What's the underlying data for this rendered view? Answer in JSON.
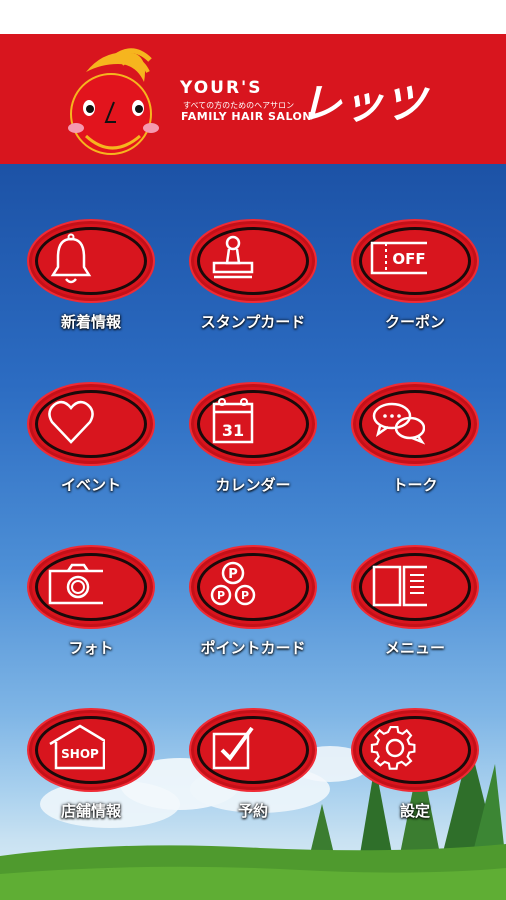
{
  "header": {
    "brand_line1": "YOUR'S",
    "brand_tagline": "すべての方のためのヘアサロン",
    "brand_line2": "FAMILY HAIR SALON",
    "brand_name": "レッツ",
    "accent_color": "#d8151e"
  },
  "menu": {
    "items": [
      {
        "label": "新着情報",
        "icon": "bell-icon"
      },
      {
        "label": "スタンプカード",
        "icon": "stamp-icon"
      },
      {
        "label": "クーポン",
        "icon": "coupon-icon",
        "icon_text": "OFF"
      },
      {
        "label": "イベント",
        "icon": "heart-icon"
      },
      {
        "label": "カレンダー",
        "icon": "calendar-icon",
        "icon_text": "31"
      },
      {
        "label": "トーク",
        "icon": "chat-bubbles-icon"
      },
      {
        "label": "フォト",
        "icon": "camera-icon"
      },
      {
        "label": "ポイントカード",
        "icon": "points-icon",
        "icon_text": "P"
      },
      {
        "label": "メニュー",
        "icon": "open-book-icon"
      },
      {
        "label": "店舗情報",
        "icon": "shop-icon",
        "icon_text": "SHOP"
      },
      {
        "label": "予約",
        "icon": "checkbox-icon"
      },
      {
        "label": "設定",
        "icon": "gear-icon"
      }
    ]
  }
}
